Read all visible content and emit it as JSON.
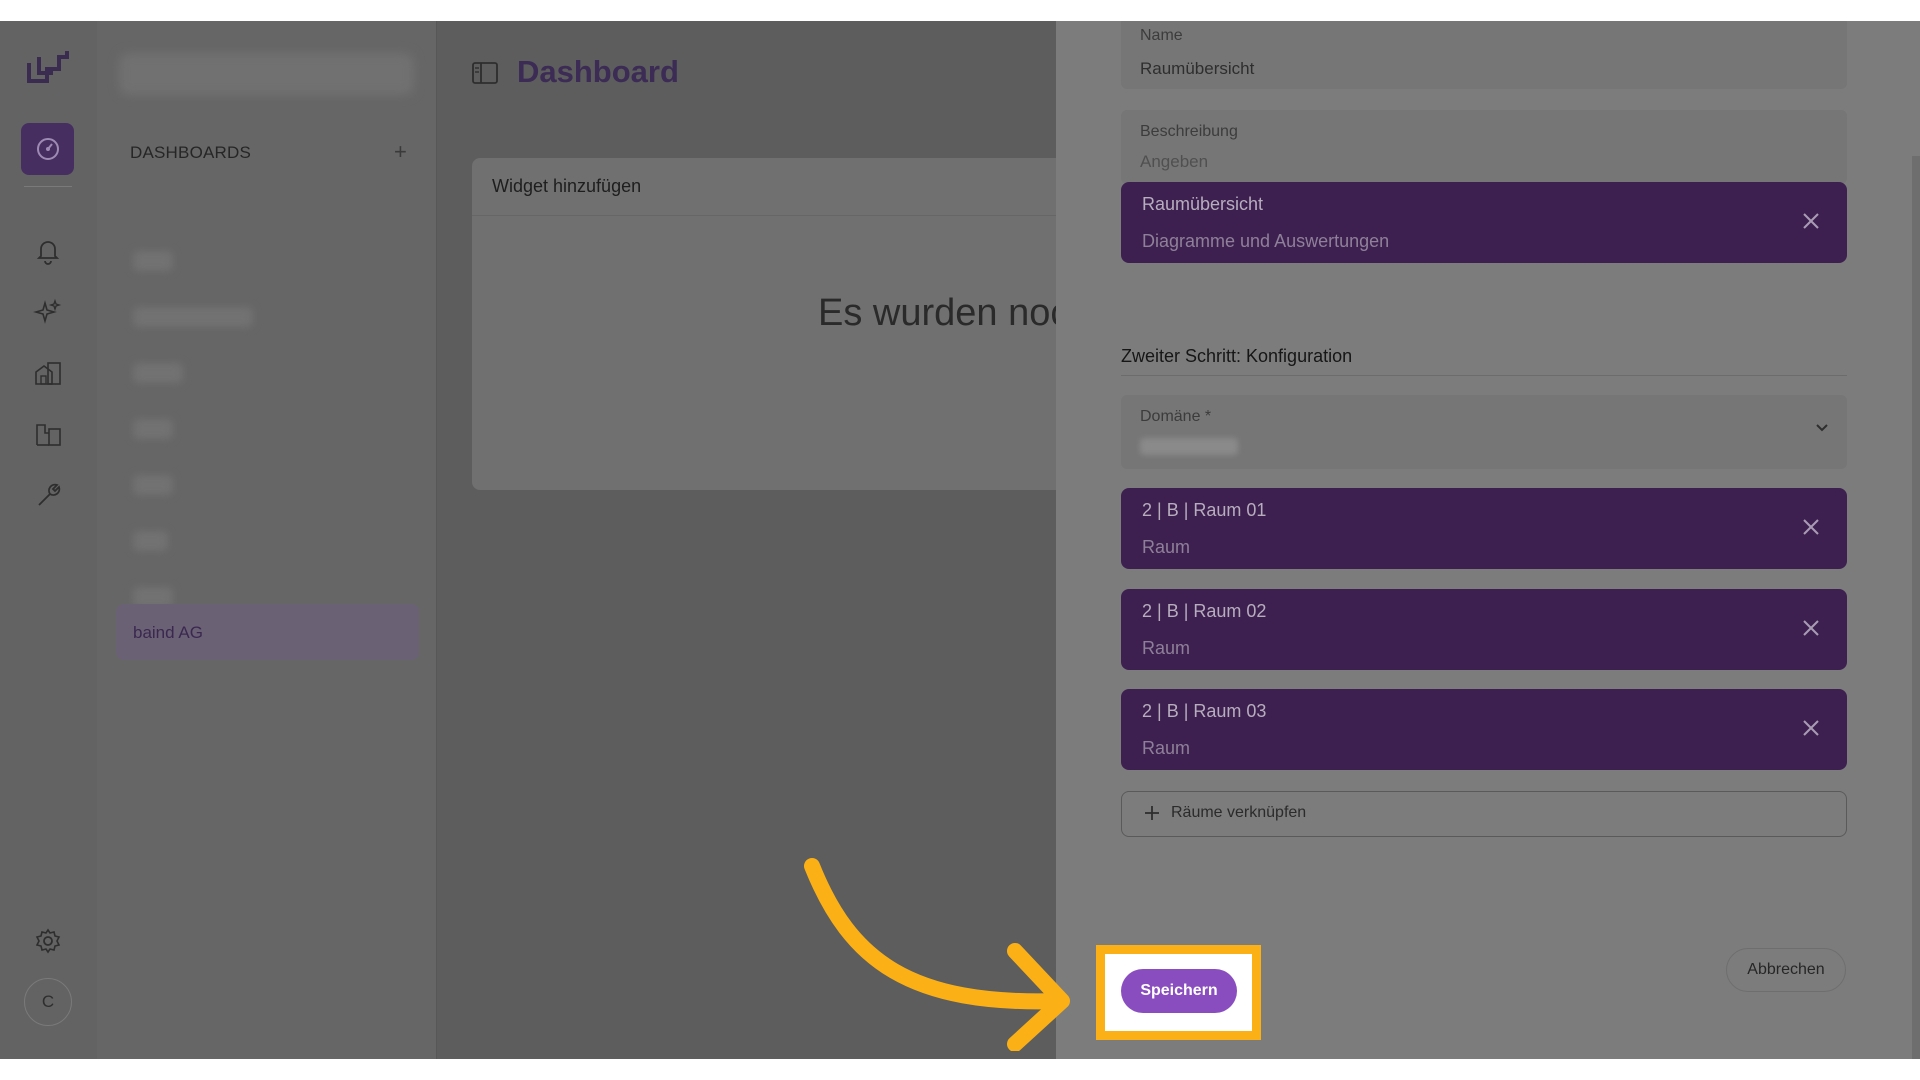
{
  "app": {
    "avatar_initial": "C"
  },
  "sidebar": {
    "section_title": "DASHBOARDS",
    "add_icon": "plus-icon",
    "active_item": "baind AG"
  },
  "main": {
    "title": "Dashboard",
    "widget_card": {
      "header": "Widget hinzufügen",
      "empty_text": "Es wurden noc"
    }
  },
  "drawer": {
    "name_field": {
      "label": "Name",
      "value": "Raumübersicht"
    },
    "description_field": {
      "label": "Beschreibung",
      "placeholder": "Angeben"
    },
    "selected_type": {
      "title": "Raumübersicht",
      "subtitle": "Diagramme und Auswertungen"
    },
    "step2_heading": "Zweiter Schritt: Konfiguration",
    "domain_field": {
      "label": "Domäne *"
    },
    "rooms": [
      {
        "title": "2 | B | Raum 01",
        "subtitle": "Raum"
      },
      {
        "title": "2 | B | Raum 02",
        "subtitle": "Raum"
      },
      {
        "title": "2 | B | Raum 03",
        "subtitle": "Raum"
      }
    ],
    "link_rooms_label": "Räume verknüpfen",
    "save_label": "Speichern",
    "cancel_label": "Abbrechen"
  },
  "colors": {
    "accent": "#8a4dc0",
    "chip_bg": "#3d2050",
    "highlight": "#fbb116"
  }
}
